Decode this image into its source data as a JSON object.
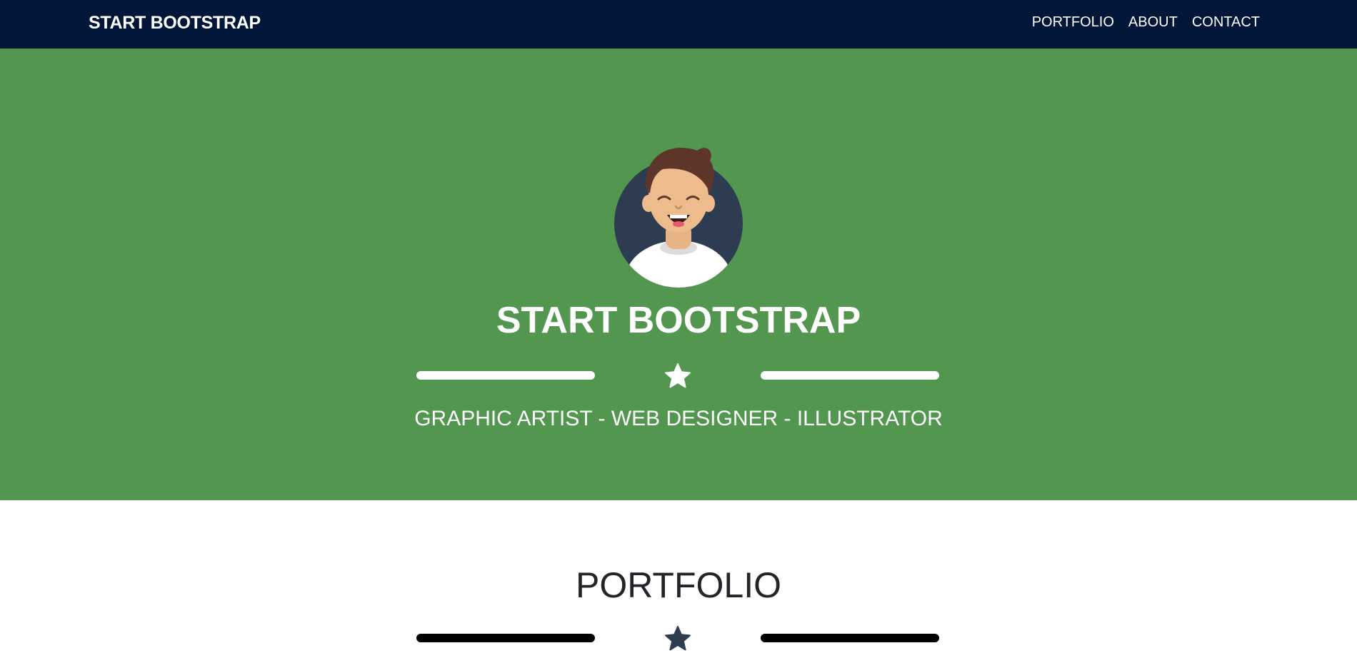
{
  "navbar": {
    "brand": "START BOOTSTRAP",
    "links": [
      {
        "label": "PORTFOLIO"
      },
      {
        "label": "ABOUT"
      },
      {
        "label": "CONTACT"
      }
    ]
  },
  "hero": {
    "title": "START BOOTSTRAP",
    "subtitle": "GRAPHIC ARTIST - WEB DESIGNER - ILLUSTRATOR",
    "divider_icon": "star-icon"
  },
  "portfolio": {
    "title": "PORTFOLIO",
    "divider_icon": "star-icon"
  },
  "colors": {
    "navbar_bg": "#011638",
    "hero_bg": "#52964f",
    "text_light": "#ffffff",
    "text_dark": "#212529"
  }
}
